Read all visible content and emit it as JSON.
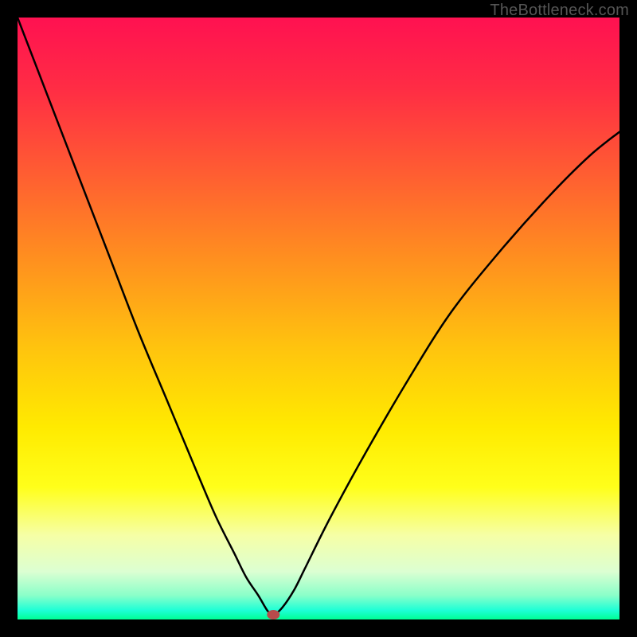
{
  "credit_text": "TheBottleneck.com",
  "chart_data": {
    "type": "line",
    "title": "",
    "xlabel": "",
    "ylabel": "",
    "xlim": [
      0,
      100
    ],
    "ylim": [
      0,
      100
    ],
    "gradient_stops": [
      {
        "pct": 0,
        "color": "#ff1151"
      },
      {
        "pct": 12,
        "color": "#ff2d44"
      },
      {
        "pct": 25,
        "color": "#ff5a33"
      },
      {
        "pct": 40,
        "color": "#ff8f1f"
      },
      {
        "pct": 55,
        "color": "#ffc40e"
      },
      {
        "pct": 68,
        "color": "#ffea00"
      },
      {
        "pct": 78,
        "color": "#ffff1a"
      },
      {
        "pct": 86,
        "color": "#f6ffa6"
      },
      {
        "pct": 92,
        "color": "#dcffd2"
      },
      {
        "pct": 96,
        "color": "#8affc9"
      },
      {
        "pct": 98.5,
        "color": "#1dffd6"
      },
      {
        "pct": 100,
        "color": "#00ff94"
      }
    ],
    "series": [
      {
        "name": "bottleneck-curve",
        "x": [
          0,
          5,
          10,
          15,
          20,
          25,
          30,
          33,
          36,
          38,
          40,
          41.5,
          42.5,
          44,
          46,
          48,
          52,
          58,
          65,
          72,
          80,
          88,
          95,
          100
        ],
        "y": [
          100,
          87,
          74,
          61,
          48,
          36,
          24,
          17,
          11,
          7,
          4,
          1.5,
          0.8,
          2,
          5,
          9,
          17,
          28,
          40,
          51,
          61,
          70,
          77,
          81
        ]
      }
    ],
    "marker": {
      "x": 42.5,
      "y": 0.8,
      "color": "#b74b4b",
      "rx": 8,
      "ry": 6
    },
    "colors": {
      "frame": "#000000",
      "curve": "#000000",
      "credit": "#555555"
    }
  }
}
